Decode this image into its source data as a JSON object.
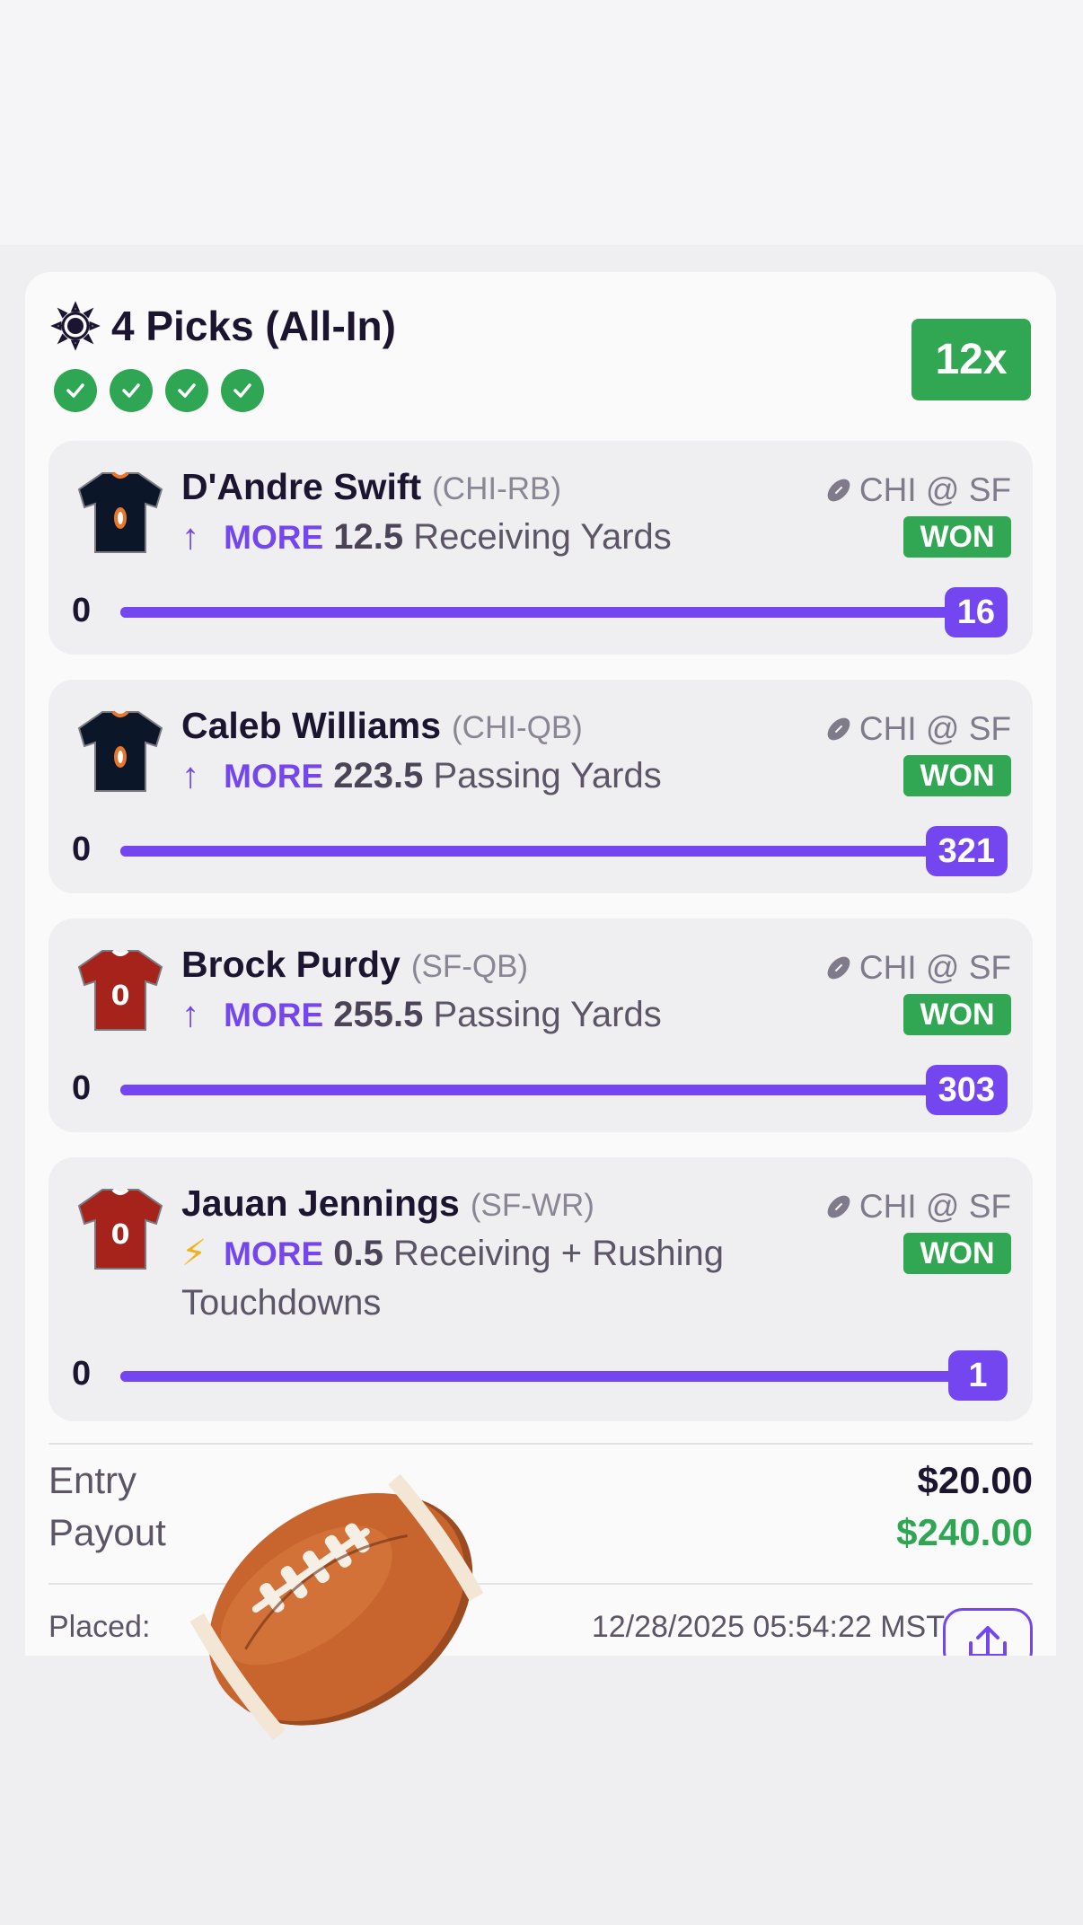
{
  "header": {
    "title": "4 Picks (All-In)",
    "checks": 4,
    "multiplier": "12x"
  },
  "picks": [
    {
      "player": "D'Andre Swift",
      "position": "(CHI-RB)",
      "team": "CHI",
      "jersey_color": "#0b1628",
      "indicator": "arrow",
      "direction": "MORE",
      "line": "12.5",
      "stat": "Receiving Yards",
      "matchup": "CHI @ SF",
      "status": "WON",
      "start": "0",
      "result": "16"
    },
    {
      "player": "Caleb Williams",
      "position": "(CHI-QB)",
      "team": "CHI",
      "jersey_color": "#0b1628",
      "indicator": "arrow",
      "direction": "MORE",
      "line": "223.5",
      "stat": "Passing Yards",
      "matchup": "CHI @ SF",
      "status": "WON",
      "start": "0",
      "result": "321"
    },
    {
      "player": "Brock Purdy",
      "position": "(SF-QB)",
      "team": "SF",
      "jersey_color": "#a6231c",
      "indicator": "arrow",
      "direction": "MORE",
      "line": "255.5",
      "stat": "Passing Yards",
      "matchup": "CHI @ SF",
      "status": "WON",
      "start": "0",
      "result": "303"
    },
    {
      "player": "Jauan Jennings",
      "position": "(SF-WR)",
      "team": "SF",
      "jersey_color": "#a6231c",
      "indicator": "bolt",
      "direction": "MORE",
      "line": "0.5",
      "stat": "Receiving + Rushing Touchdowns",
      "matchup": "CHI @ SF",
      "status": "WON",
      "start": "0",
      "result": "1"
    }
  ],
  "summary": {
    "entry_label": "Entry",
    "entry_value": "$20.00",
    "payout_label": "Payout",
    "payout_value": "$240.00",
    "placed_label": "Placed:",
    "placed_time": "12/28/2025 05:54:22 MST"
  },
  "colors": {
    "accent": "#7346f0",
    "won": "#31a653",
    "payout": "#2fa653"
  }
}
